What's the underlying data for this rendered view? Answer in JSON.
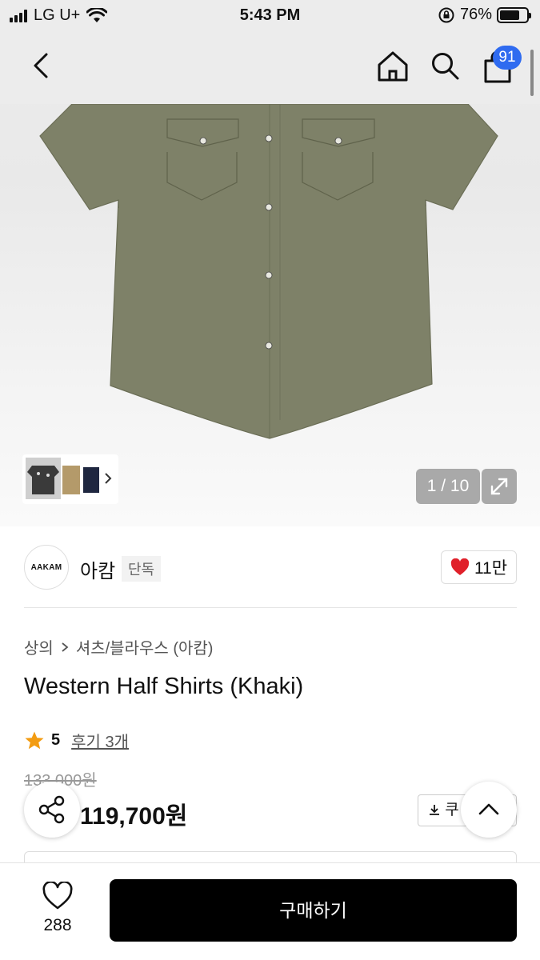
{
  "status_bar": {
    "carrier": "LG U+",
    "time": "5:43 PM",
    "battery": "76%",
    "battery_level": 0.76,
    "icons": [
      "signal-icon",
      "wifi-icon",
      "orientation-lock-icon",
      "battery-icon"
    ]
  },
  "nav": {
    "cart_count": "91",
    "icons": [
      "back-arrow-icon",
      "home-icon",
      "search-icon",
      "shopping-bag-icon"
    ]
  },
  "gallery": {
    "counter": "1 / 10",
    "icons": [
      "chevron-right-icon",
      "expand-icon"
    ]
  },
  "brand": {
    "logo_text": "AAKAM",
    "name": "아캄",
    "tag": "단독",
    "likes": "11만"
  },
  "breadcrumb": {
    "category": "상의",
    "subcategory": "셔츠/블라우스 (아캄)"
  },
  "product": {
    "title": "Western Half Shirts (Khaki)",
    "rating": "5",
    "reviews": "후기 3개",
    "original_price": "133,000원",
    "price": "119,700원",
    "coupon_label": "쿠"
  },
  "bottom_bar": {
    "wish_count": "288",
    "buy_label": "구매하기"
  },
  "colors": {
    "accent_blue": "#2f6bf0",
    "heart_red": "#e0202a",
    "star_orange": "#f39c12",
    "shirt_khaki": "#7e8168"
  }
}
